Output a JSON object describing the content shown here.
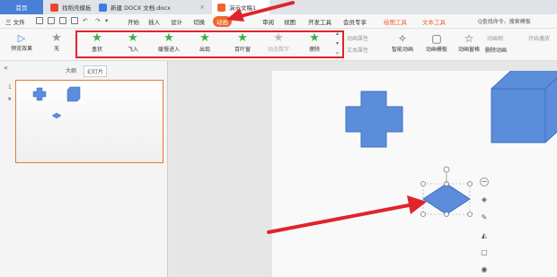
{
  "tabs": {
    "home": "首页",
    "tab1": "找稻壳模板",
    "tab2": "新建 DOCX 文档.docx",
    "tab3": "演示文稿1",
    "close": "×",
    "colors": {
      "tab1_icon": "#e9462f",
      "tab2_icon": "#3b7de0",
      "tab3_icon": "#f0652b"
    }
  },
  "menu": {
    "file": "三 文件",
    "items": [
      "开始",
      "插入",
      "设计",
      "切换",
      "动画",
      "审阅",
      "视图",
      "开发工具",
      "会员专享"
    ],
    "active_index": 4,
    "drawing_tools": "绘图工具",
    "text_tools": "文本工具",
    "search": "Q查找命令、搜索模板"
  },
  "ribbon": {
    "preview": "预览效果",
    "none": "无",
    "animations": [
      {
        "label": "盒状",
        "enabled": true
      },
      {
        "label": "飞入",
        "enabled": true
      },
      {
        "label": "缓慢进入",
        "enabled": true
      },
      {
        "label": "出现",
        "enabled": true
      },
      {
        "label": "百叶窗",
        "enabled": true
      },
      {
        "label": "动态数字",
        "enabled": false
      },
      {
        "label": "擦除",
        "enabled": true
      }
    ],
    "anim_props": "动画属性",
    "text_props": "文本属性",
    "smart_anim": "智能动画",
    "anim_template": "动画模板",
    "anim_pane": "动画窗格",
    "delete_anim": "删除动画",
    "anim_brush": "动画刷",
    "start_play": "开始播放"
  },
  "panel": {
    "outline_tab": "大纲",
    "slides_tab": "幻灯片",
    "slide_number": "1",
    "slide_marker": "★"
  },
  "accent_color": "#f0652b",
  "shape_color": "#5b8ddb",
  "annotation_color": "#e0242b"
}
